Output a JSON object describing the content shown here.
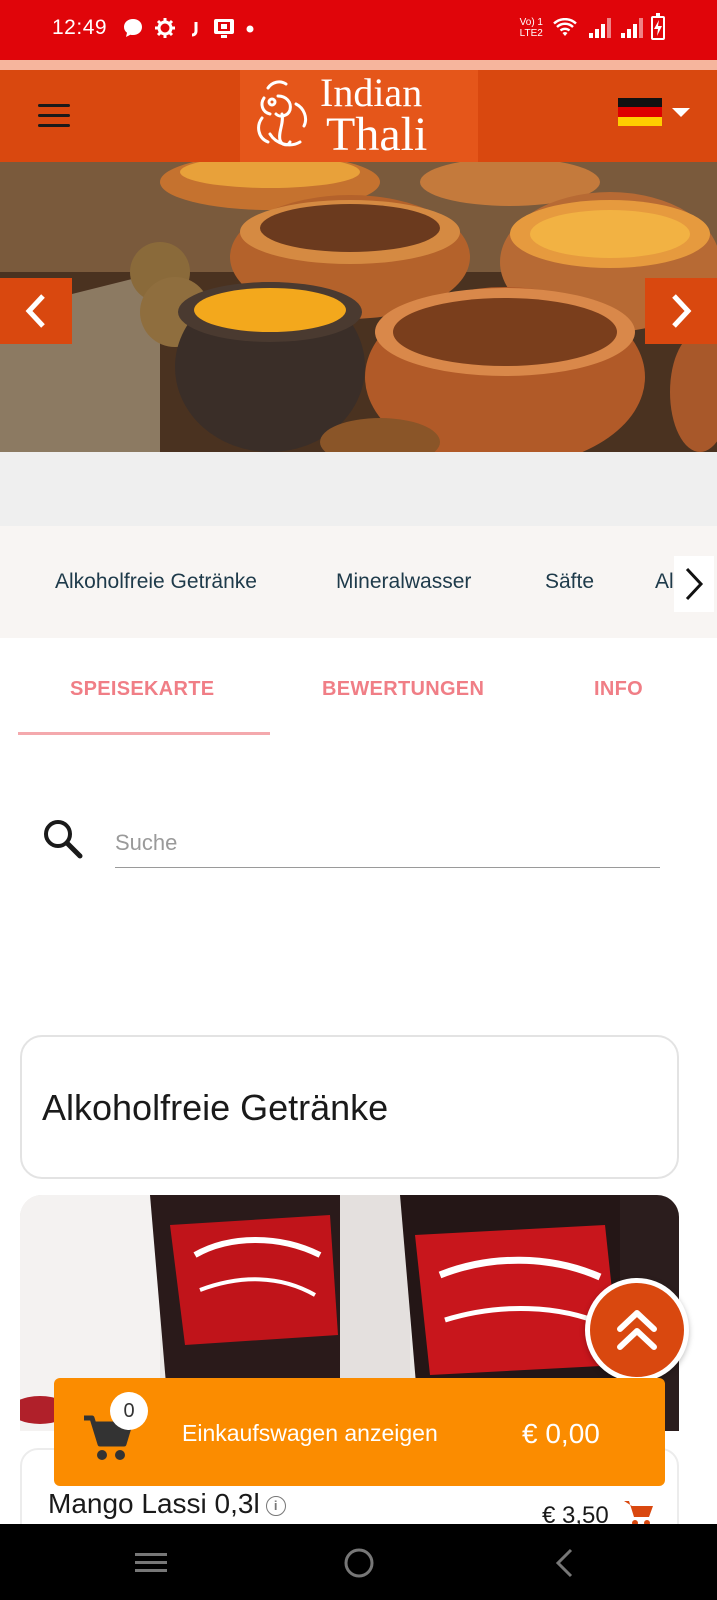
{
  "status_bar": {
    "time": "12:49",
    "left_icons": [
      "message-icon",
      "settings-gear-icon",
      "j-app-icon",
      "cast-icon",
      "dot-icon"
    ],
    "network_label_top": "Vo) 1",
    "network_label_bottom": "LTE2",
    "right_icons": [
      "wifi-icon",
      "signal-icon",
      "signal-icon",
      "battery-charging-icon"
    ]
  },
  "header": {
    "menu_icon": "hamburger-icon",
    "logo_line1": "Indian",
    "logo_line2": "Thali",
    "language_flag": "germany-flag-icon",
    "language_caret": "chevron-down-icon"
  },
  "hero": {
    "prev_icon": "chevron-left-icon",
    "next_icon": "chevron-right-icon"
  },
  "categories": {
    "items": [
      "Alkoholfreie Getränke",
      "Mineralwasser",
      "Säfte",
      "Al"
    ],
    "next_icon": "chevron-right-icon"
  },
  "tabs": {
    "items": [
      "SPEISEKARTE",
      "BEWERTUNGEN",
      "INFO"
    ],
    "active": "SPEISEKARTE"
  },
  "search": {
    "placeholder": "Suche",
    "value": ""
  },
  "section": {
    "title": "Alkoholfreie Getränke"
  },
  "product": {
    "name": "Mango Lassi 0,3l",
    "price": "€ 3,50"
  },
  "cart": {
    "count": "0",
    "label": "Einkaufswagen anzeigen",
    "total": "€ 0,00"
  },
  "colors": {
    "status_red": "#e0050a",
    "header_orange": "#d9480f",
    "tab_pink": "#f07e86",
    "cart_orange": "#fb8c00",
    "category_text": "#1e3a4a"
  }
}
